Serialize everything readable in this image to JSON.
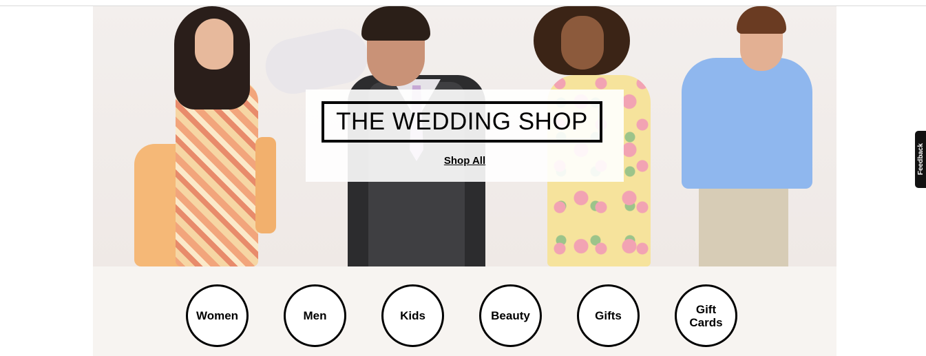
{
  "hero": {
    "title": "THE WEDDING SHOP",
    "link": "Shop All"
  },
  "categories": [
    {
      "label": "Women"
    },
    {
      "label": "Men"
    },
    {
      "label": "Kids"
    },
    {
      "label": "Beauty"
    },
    {
      "label": "Gifts"
    },
    {
      "label": "Gift Cards"
    }
  ],
  "feedback": {
    "label": "Feedback"
  },
  "colors": {
    "accent": "#000000",
    "band": "#f7f4f1",
    "hero_bg": "#f1ece9"
  }
}
